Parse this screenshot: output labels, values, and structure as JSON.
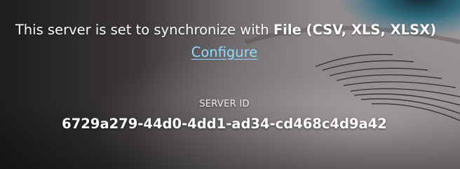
{
  "sync": {
    "text": "This server is set to synchronize with ",
    "source": "File (CSV, XLS, XLSX)"
  },
  "configure": {
    "label": "Configure"
  },
  "server": {
    "id_label": "SERVER ID",
    "id_value": "6729a279-44d0-4dd1-ad34-cd468c4d9a42"
  },
  "colors": {
    "link": "#8fdcff",
    "text": "#ffffff",
    "eye_iris": "#3d7f95"
  },
  "background": {
    "image": "eye-closeup-photo"
  }
}
